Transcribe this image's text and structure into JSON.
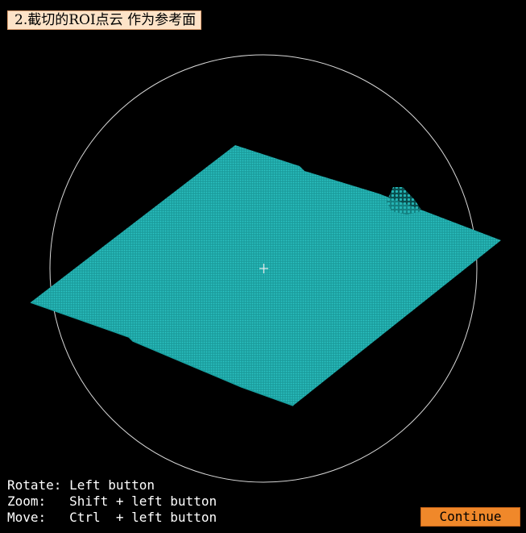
{
  "window": {
    "title": "2.截切的ROI点云 作为参考面"
  },
  "view": {
    "point_cloud_color": "#1fa6a6",
    "sphere_color": "#d8d8d8",
    "background_color": "#000000"
  },
  "help": {
    "rotate": "Rotate: Left button",
    "zoom": "Zoom:   Shift + left button",
    "move": "Move:   Ctrl  + left button"
  },
  "buttons": {
    "continue_label": "Continue",
    "continue_color": "#f0882a"
  }
}
